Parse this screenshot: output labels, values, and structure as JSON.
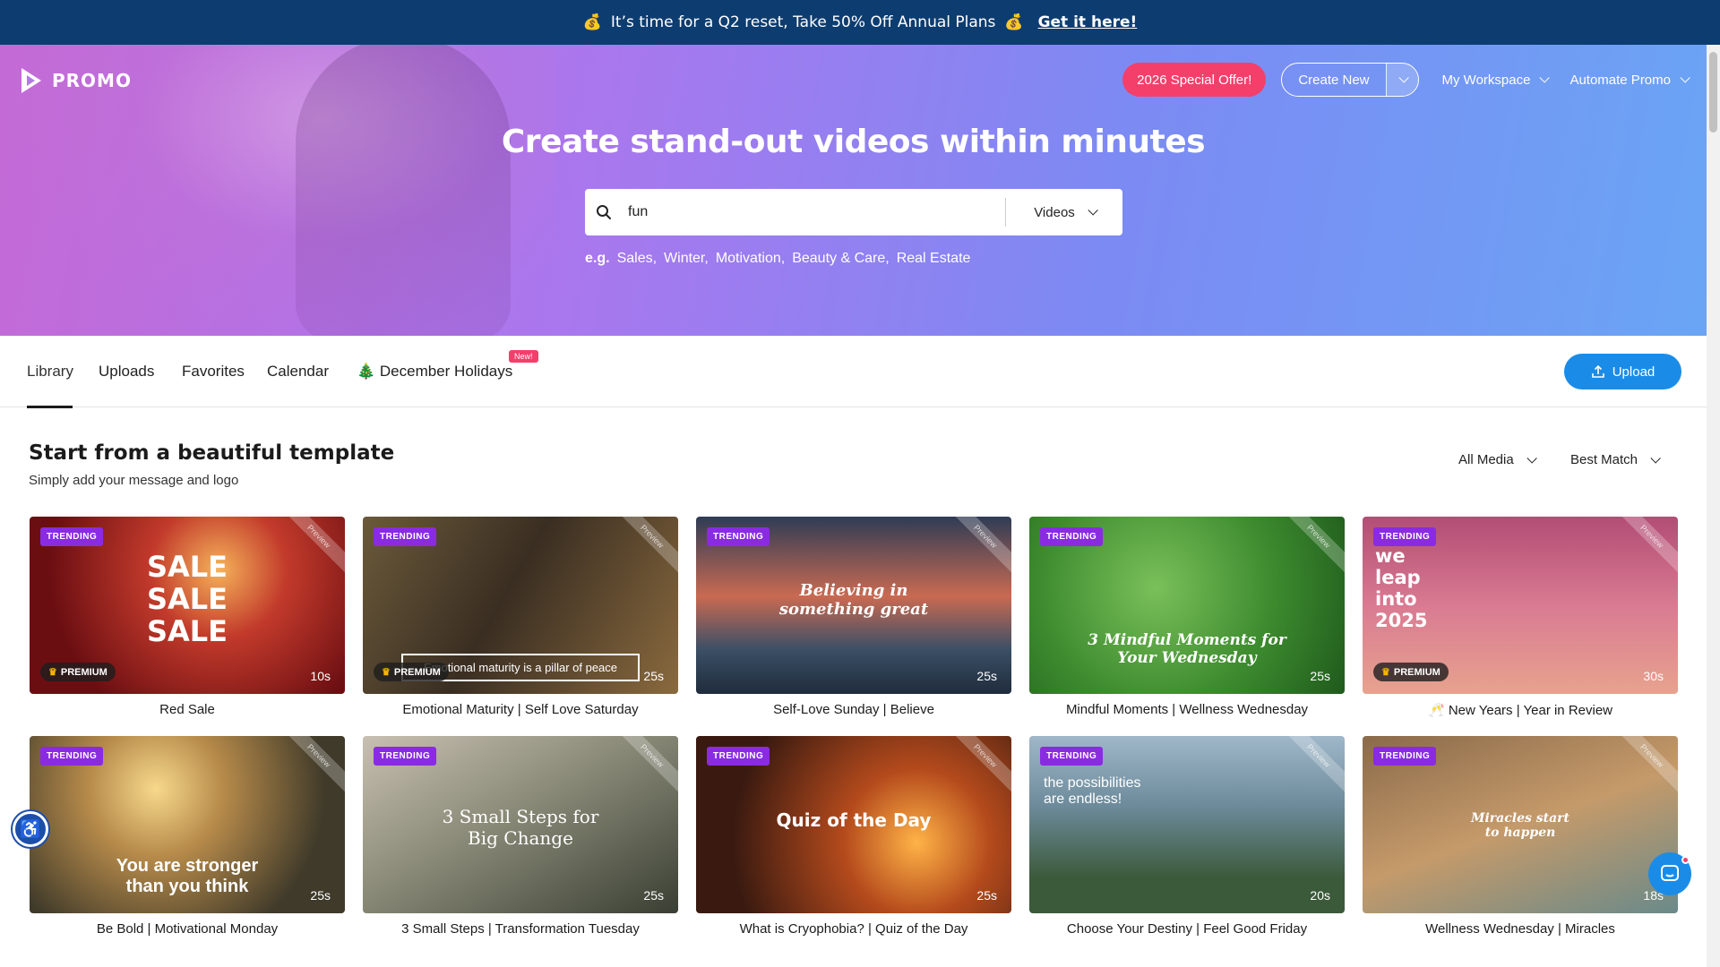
{
  "promo_bar": {
    "emoji_left": "💰",
    "message": "It’s time for a Q2 reset, Take 50% Off Annual Plans",
    "emoji_right": "💰",
    "cta": "Get it here!"
  },
  "header": {
    "logo": "PROMO",
    "special_offer": "2026 Special Offer!",
    "create_new": "Create New",
    "my_workspace": "My Workspace",
    "automate_promo": "Automate Promo"
  },
  "hero": {
    "title": "Create stand-out videos within minutes",
    "search_value": "fun",
    "search_type": "Videos",
    "examples_label": "e.g.",
    "examples": [
      "Sales,",
      "Winter,",
      "Motivation,",
      "Beauty & Care,",
      "Real Estate"
    ]
  },
  "tabs": {
    "library": "Library",
    "uploads": "Uploads",
    "favorites": "Favorites",
    "calendar": "Calendar",
    "holiday_emoji": "🎄",
    "holidays": "December Holidays",
    "new_badge": "New!",
    "upload": "Upload"
  },
  "section": {
    "title": "Start from a beautiful template",
    "subtitle": "Simply add your message and logo",
    "filter_media": "All Media",
    "filter_sort": "Best Match"
  },
  "labels": {
    "trending": "TRENDING",
    "premium": "PREMIUM",
    "preview": "Preview"
  },
  "templates": [
    {
      "caption": "Red Sale",
      "duration": "10s",
      "overlay": "SALE\nSALE\nSALE",
      "premium": true
    },
    {
      "caption": "Emotional Maturity | Self Love Saturday",
      "duration": "25s",
      "overlay": "Emotional maturity is a pillar of peace",
      "premium": true
    },
    {
      "caption": "Self-Love Sunday | Believe",
      "duration": "25s",
      "overlay": "Believing in\nsomething great",
      "premium": false
    },
    {
      "caption": "Mindful Moments | Wellness Wednesday",
      "duration": "25s",
      "overlay": "3 Mindful Moments for\nYour Wednesday",
      "premium": false
    },
    {
      "caption": "🥂 New Years | Year in Review",
      "duration": "30s",
      "overlay": "we\nleap\ninto\n2025",
      "premium": true
    },
    {
      "caption": "Be Bold | Motivational Monday",
      "duration": "25s",
      "overlay": "You are stronger\nthan you think",
      "premium": false
    },
    {
      "caption": "3 Small Steps | Transformation Tuesday",
      "duration": "25s",
      "overlay": "3 Small Steps for\nBig Change",
      "premium": false
    },
    {
      "caption": "What is Cryophobia? | Quiz of the Day",
      "duration": "25s",
      "overlay": "Quiz of the Day",
      "premium": false
    },
    {
      "caption": "Choose Your Destiny | Feel Good Friday",
      "duration": "20s",
      "overlay": "the possibilities\nare endless!",
      "premium": false
    },
    {
      "caption": "Wellness Wednesday | Miracles",
      "duration": "18s",
      "overlay": "Miracles start\nto happen",
      "premium": false
    }
  ],
  "colors": {
    "accent": "#1a8ce8",
    "trending": "#8a2be2",
    "offer": "#f43f6b",
    "promo_bar": "#0d3d70"
  }
}
